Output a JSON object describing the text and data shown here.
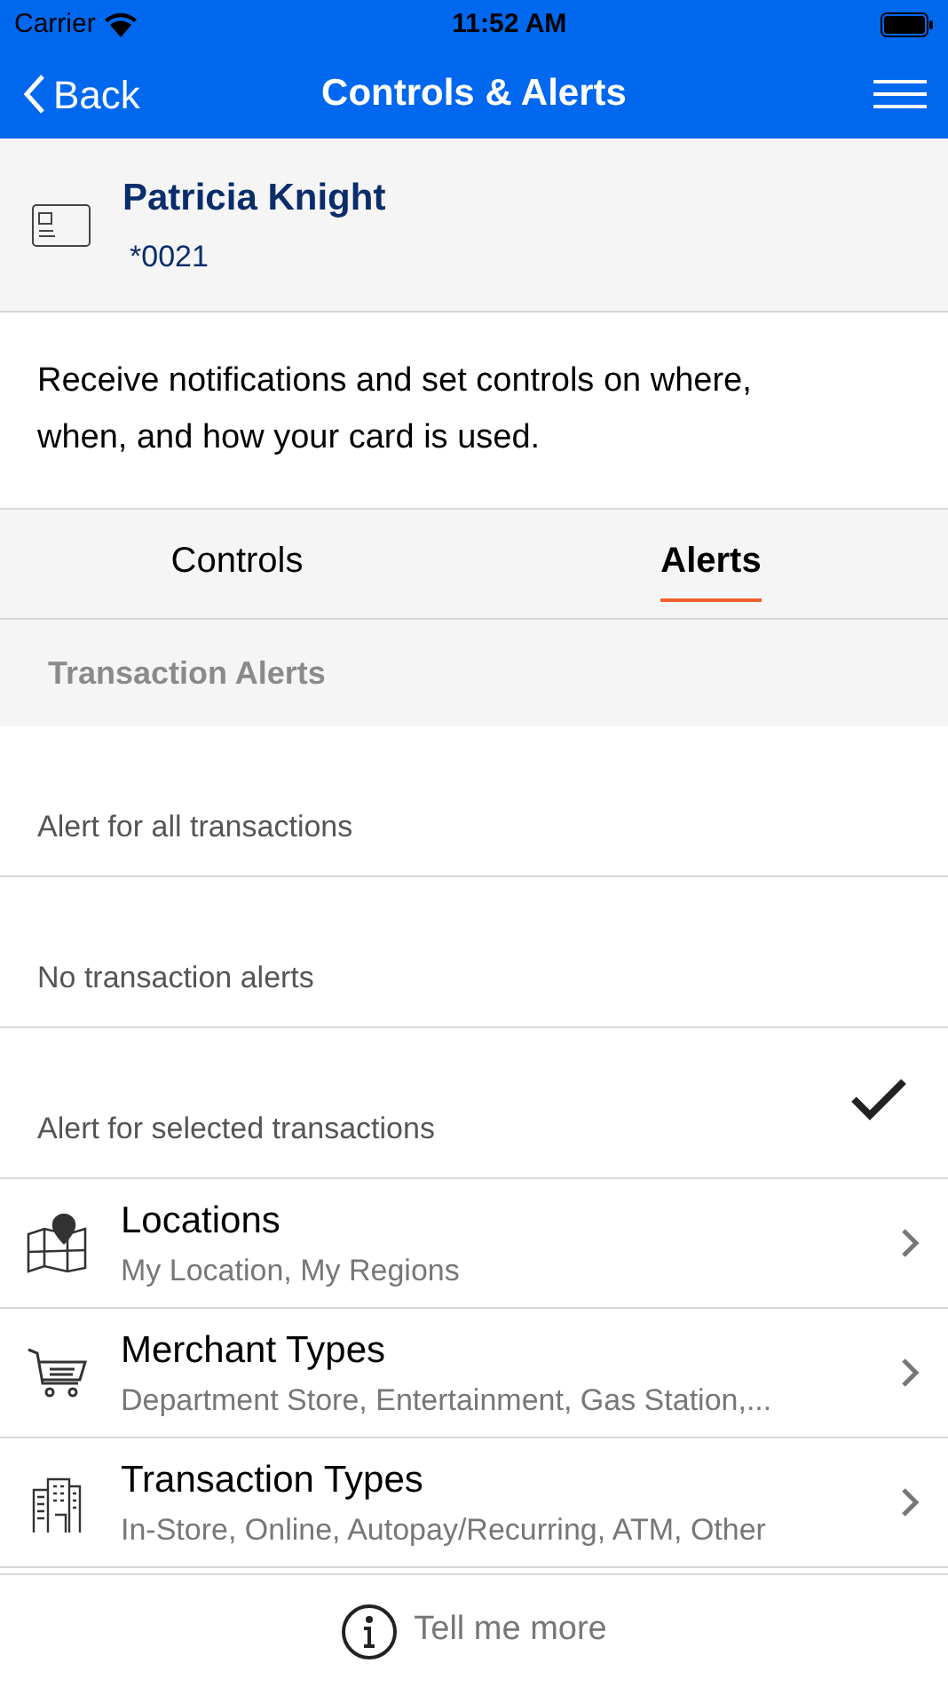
{
  "status_bar": {
    "carrier": "Carrier",
    "time": "11:52 AM"
  },
  "nav": {
    "back": "Back",
    "title": "Controls & Alerts"
  },
  "card": {
    "name": "Patricia Knight",
    "number": "*0021"
  },
  "description": "Receive notifications and set controls on where, when, and how your card is used.",
  "tabs": [
    {
      "label": "Controls",
      "selected": false
    },
    {
      "label": "Alerts",
      "selected": true
    }
  ],
  "section_title": "Transaction Alerts",
  "options": [
    {
      "label": "Alert for all transactions",
      "selected": false
    },
    {
      "label": "No transaction alerts",
      "selected": false
    },
    {
      "label": "Alert for selected transactions",
      "selected": true
    }
  ],
  "categories": [
    {
      "kind": "map",
      "title": "Locations",
      "subtitle": "My Location, My Regions"
    },
    {
      "kind": "cart",
      "title": "Merchant Types",
      "subtitle": "Department Store, Entertainment, Gas Station,..."
    },
    {
      "kind": "buildings",
      "title": "Transaction Types",
      "subtitle": "In-Store, Online, Autopay/Recurring, ATM, Other"
    }
  ],
  "footer": {
    "label": "Tell me more"
  }
}
